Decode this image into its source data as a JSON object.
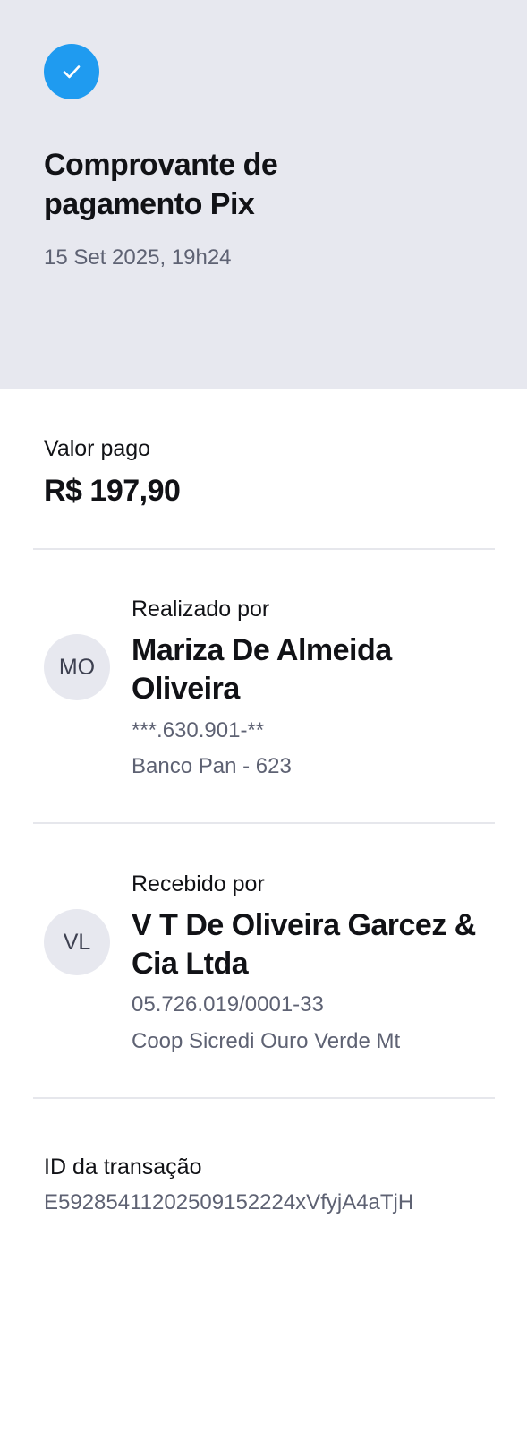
{
  "header": {
    "title": "Comprovante de pagamento Pix",
    "datetime": "15 Set 2025, 19h24",
    "check_icon": "check-icon",
    "accent_color": "#1f9bf0",
    "background_color": "#e7e8ef"
  },
  "amount": {
    "label": "Valor pago",
    "value": "R$ 197,90"
  },
  "payer": {
    "caption": "Realizado por",
    "initials": "MO",
    "name": "Mariza De Almeida Oliveira",
    "document": "***.630.901-**",
    "bank": "Banco Pan - 623"
  },
  "payee": {
    "caption": "Recebido por",
    "initials": "VL",
    "name": "V T De Oliveira Garcez & Cia Ltda",
    "document": "05.726.019/0001-33",
    "bank": "Coop Sicredi Ouro Verde Mt"
  },
  "transaction": {
    "label": "ID da transação",
    "id": "E59285411202509152224xVfyjA4aTjH"
  }
}
